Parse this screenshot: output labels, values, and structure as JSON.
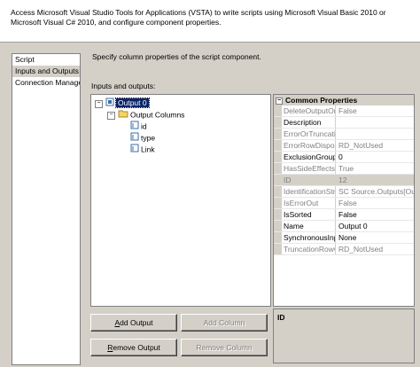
{
  "header": {
    "text": "Access Microsoft Visual Studio Tools for Applications (VSTA) to write scripts using Microsoft Visual Basic 2010 or Microsoft Visual C# 2010, and configure component properties."
  },
  "nav": {
    "items": [
      {
        "label": "Script",
        "selected": false
      },
      {
        "label": "Inputs and Outputs",
        "selected": true
      },
      {
        "label": "Connection Managers",
        "selected": false
      }
    ]
  },
  "description": "Specify column properties of the script component.",
  "tree_label": "Inputs and outputs:",
  "tree": {
    "output": "Output 0",
    "folder": "Output Columns",
    "columns": [
      "id",
      "type",
      "Link"
    ]
  },
  "grid": {
    "category": "Common Properties",
    "rows": [
      {
        "name": "DeleteOutputOn",
        "value": "False",
        "enabled": false
      },
      {
        "name": "Description",
        "value": "",
        "enabled": true
      },
      {
        "name": "ErrorOrTruncatio",
        "value": "",
        "enabled": false
      },
      {
        "name": "ErrorRowDisposi",
        "value": "RD_NotUsed",
        "enabled": false
      },
      {
        "name": "ExclusionGroup",
        "value": "0",
        "enabled": true
      },
      {
        "name": "HasSideEffects",
        "value": "True",
        "enabled": false
      },
      {
        "name": "ID",
        "value": "12",
        "enabled": false
      },
      {
        "name": "IdentificationStr",
        "value": "SC Source.Outputs[Ou",
        "enabled": false
      },
      {
        "name": "IsErrorOut",
        "value": "False",
        "enabled": false
      },
      {
        "name": "IsSorted",
        "value": "False",
        "enabled": true
      },
      {
        "name": "Name",
        "value": "Output 0",
        "enabled": true
      },
      {
        "name": "SynchronousInp",
        "value": "None",
        "enabled": true
      },
      {
        "name": "TruncationRowC",
        "value": "RD_NotUsed",
        "enabled": false
      }
    ]
  },
  "desc_box": {
    "title": "ID"
  },
  "buttons": {
    "add_output": {
      "mnemonic": "A",
      "rest": "dd Output"
    },
    "add_column": {
      "label": "Add Column"
    },
    "remove_output": {
      "mnemonic": "R",
      "rest": "emove Output"
    },
    "remove_column": {
      "label": "Remove Column"
    }
  }
}
